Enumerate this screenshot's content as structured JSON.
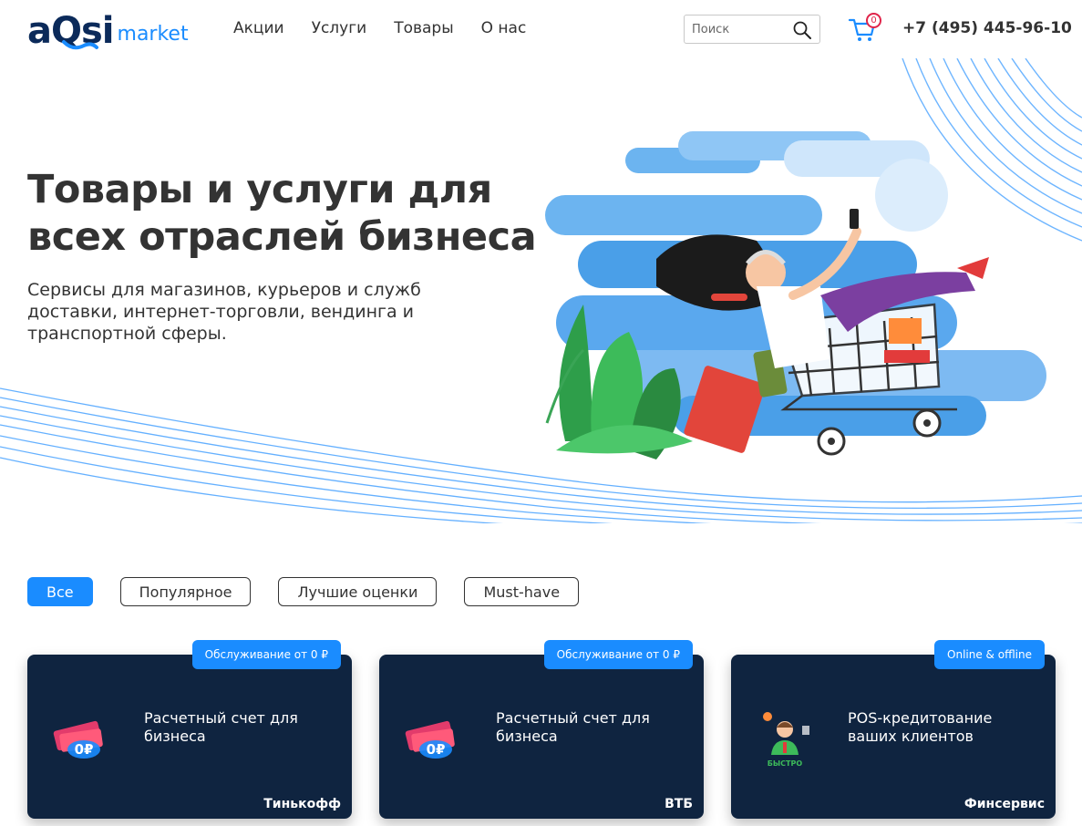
{
  "header": {
    "logo_main": "aQsi",
    "logo_sub": "market",
    "nav": [
      "Акции",
      "Услуги",
      "Товары",
      "О нас"
    ],
    "search_placeholder": "Поиск",
    "cart_count": "0",
    "phone": "+7 (495) 445-96-10"
  },
  "hero": {
    "title": "Товары и услуги для всех отраслей бизнеса",
    "subtitle": "Сервисы для магазинов, курьеров и служб доставки, интернет-торговли, вендинга и транспортной сферы."
  },
  "filters": {
    "items": [
      "Все",
      "Популярное",
      "Лучшие оценки",
      "Must-have"
    ],
    "active": "Все"
  },
  "cards": [
    {
      "tag": "Обслуживание от 0 ₽",
      "title": "Расчетный счет для бизнеса",
      "provider": "Тинькофф",
      "icon_text": "0₽",
      "icon": "zero-rubles-icon"
    },
    {
      "tag": "Обслуживание от 0 ₽",
      "title": "Расчетный счет для бизнеса",
      "provider": "ВТБ",
      "icon_text": "0₽",
      "icon": "zero-rubles-icon"
    },
    {
      "tag": "Online & offline",
      "title": "POS-кредитование ваших клиентов",
      "provider": "Финсервис",
      "icon_text": "БЫСТРО",
      "icon": "fast-credit-man-icon"
    }
  ],
  "colors": {
    "accent": "#1a8cff",
    "dark_card": "#0f2440",
    "badge": "#e0244a",
    "logo_dark": "#0b2a5a"
  }
}
